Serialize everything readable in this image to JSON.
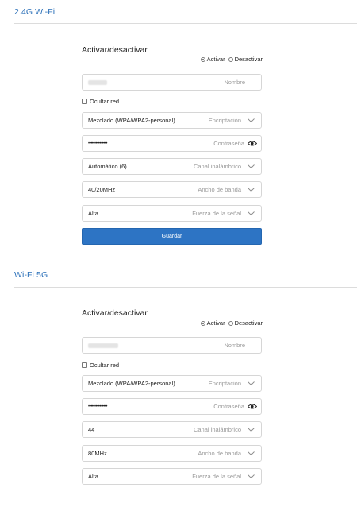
{
  "sections": [
    {
      "title": "2.4G Wi-Fi",
      "toggle_heading": "Activar/desactivar",
      "radio_on_label": "Activar",
      "radio_off_label": "Desactivar",
      "radio_selected": "Activar",
      "name_label": "Nombre",
      "hide_network_label": "Ocultar red",
      "encryption_value": "Mezclado (WPA/WPA2-personal)",
      "encryption_label": "Encriptación",
      "password_value": "•••••••••••••••",
      "password_label": "Contraseña",
      "channel_value": "Automático (6)",
      "channel_label": "Canal inalámbrico",
      "bandwidth_value": "40/20MHz",
      "bandwidth_label": "Ancho de banda",
      "signal_value": "Alta",
      "signal_label": "Fuerza de la señal",
      "save_label": "Guardar"
    },
    {
      "title": "Wi-Fi 5G",
      "toggle_heading": "Activar/desactivar",
      "radio_on_label": "Activar",
      "radio_off_label": "Desactivar",
      "radio_selected": "Activar",
      "name_label": "Nombre",
      "hide_network_label": "Ocultar red",
      "encryption_value": "Mezclado (WPA/WPA2-personal)",
      "encryption_label": "Encriptación",
      "password_value": "•••••••••••••••",
      "password_label": "Contraseña",
      "channel_value": "44",
      "channel_label": "Canal inalámbrico",
      "bandwidth_value": "80MHz",
      "bandwidth_label": "Ancho de banda",
      "signal_value": "Alta",
      "signal_label": "Fuerza de la señal"
    }
  ],
  "colors": {
    "accent": "#2a6fb8",
    "button": "#2d74c4"
  }
}
